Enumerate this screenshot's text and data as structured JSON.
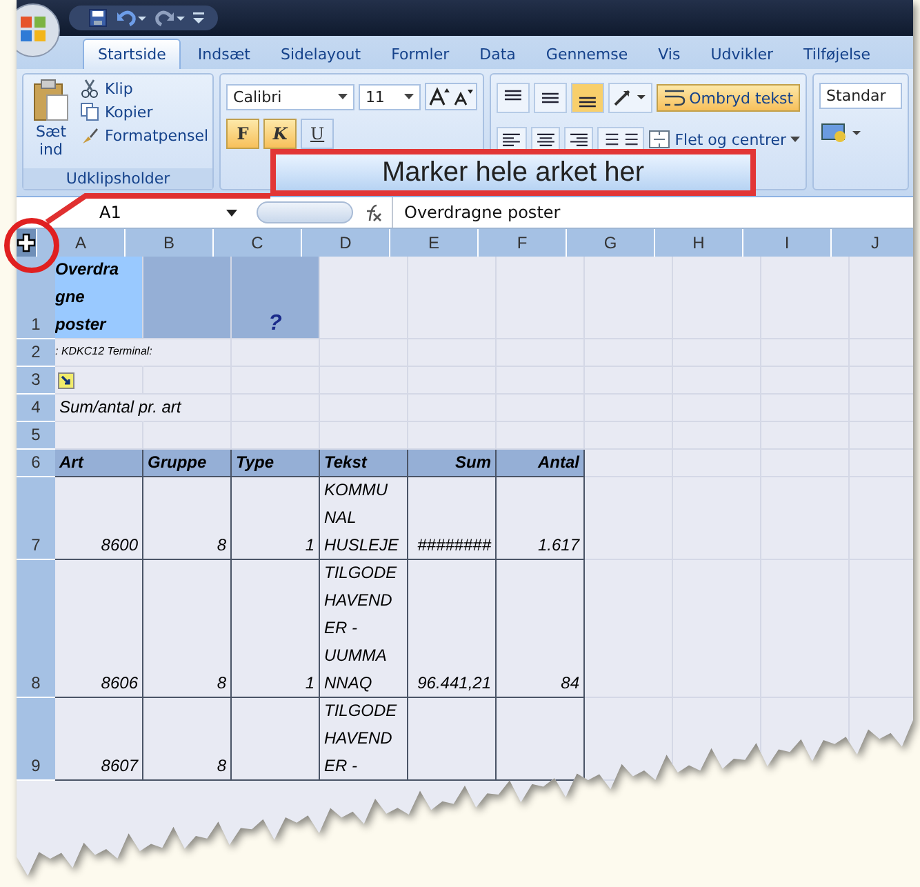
{
  "tabs": [
    {
      "label": "Startside",
      "selected": true
    },
    {
      "label": "Indsæt",
      "selected": false
    },
    {
      "label": "Sidelayout",
      "selected": false
    },
    {
      "label": "Formler",
      "selected": false
    },
    {
      "label": "Data",
      "selected": false
    },
    {
      "label": "Gennemse",
      "selected": false
    },
    {
      "label": "Vis",
      "selected": false
    },
    {
      "label": "Udvikler",
      "selected": false
    },
    {
      "label": "Tilføjelse",
      "selected": false
    }
  ],
  "ribbon": {
    "clipboard": {
      "paste_label": [
        "Sæt",
        "ind"
      ],
      "cut": "Klip",
      "copy": "Kopier",
      "format_painter": "Formatpensel",
      "group_label": "Udklipsholder"
    },
    "font": {
      "name": "Calibri",
      "size": "11",
      "bold": "F",
      "italic": "K",
      "underline": "U",
      "bold_on": true,
      "italic_on": true
    },
    "alignment": {
      "wrap_text": "Ombryd tekst",
      "wrap_on": true,
      "merge": "Flet og centrer"
    },
    "number": {
      "format": "Standar"
    }
  },
  "formula_bar": {
    "name_box": "A1",
    "value": "Overdragne poster"
  },
  "callout": {
    "text": "Marker hele arket her"
  },
  "sheet": {
    "columns": [
      "A",
      "B",
      "C",
      "D",
      "E",
      "F",
      "G",
      "H",
      "I",
      "J"
    ],
    "rows": [
      {
        "number": "1",
        "cells": [
          {
            "kind": "title",
            "lines": [
              "Overdra",
              "gne",
              "poster"
            ]
          },
          {
            "kind": "fill"
          },
          {
            "kind": "fill_mark",
            "lines": [
              "?"
            ]
          }
        ]
      },
      {
        "number": "2",
        "cells": [
          {
            "kind": "note",
            "lines": [
              ": KDKC12 Terminal:"
            ]
          }
        ]
      },
      {
        "number": "3",
        "cells": [
          {
            "kind": "icon"
          }
        ]
      },
      {
        "number": "4",
        "cells": [
          {
            "kind": "label",
            "lines": [
              "Sum/antal pr. art"
            ]
          }
        ]
      },
      {
        "number": "5",
        "cells": []
      },
      {
        "number": "6",
        "cells": [
          {
            "kind": "header",
            "lines": [
              "Art"
            ]
          },
          {
            "kind": "header",
            "lines": [
              "Gruppe"
            ]
          },
          {
            "kind": "header",
            "lines": [
              "Type"
            ]
          },
          {
            "kind": "header",
            "lines": [
              "Tekst"
            ]
          },
          {
            "kind": "header_num",
            "lines": [
              "Sum"
            ]
          },
          {
            "kind": "header_num",
            "lines": [
              "Antal"
            ]
          }
        ]
      },
      {
        "number": "7",
        "cells": [
          {
            "kind": "num",
            "lines": [
              "8600"
            ]
          },
          {
            "kind": "num",
            "lines": [
              "8"
            ]
          },
          {
            "kind": "num",
            "lines": [
              "1"
            ]
          },
          {
            "kind": "text",
            "lines": [
              "KOMMU",
              "NAL",
              "HUSLEJE"
            ]
          },
          {
            "kind": "num",
            "lines": [
              "########"
            ]
          },
          {
            "kind": "num",
            "lines": [
              "1.617"
            ]
          }
        ]
      },
      {
        "number": "8",
        "cells": [
          {
            "kind": "num",
            "lines": [
              "8606"
            ]
          },
          {
            "kind": "num",
            "lines": [
              "8"
            ]
          },
          {
            "kind": "num",
            "lines": [
              "1"
            ]
          },
          {
            "kind": "text",
            "lines": [
              "TILGODE",
              "HAVEND",
              "ER -",
              "UUMMA",
              "NNAQ"
            ]
          },
          {
            "kind": "num",
            "lines": [
              "96.441,21"
            ]
          },
          {
            "kind": "num",
            "lines": [
              "84"
            ]
          }
        ]
      },
      {
        "number": "9",
        "cells": [
          {
            "kind": "num",
            "lines": [
              "8607"
            ]
          },
          {
            "kind": "num",
            "lines": [
              "8"
            ]
          },
          {
            "kind": "table"
          },
          {
            "kind": "text",
            "lines": [
              "TILGODE",
              "HAVEND",
              "ER -"
            ]
          },
          {
            "kind": "table"
          },
          {
            "kind": "table"
          }
        ]
      }
    ]
  }
}
